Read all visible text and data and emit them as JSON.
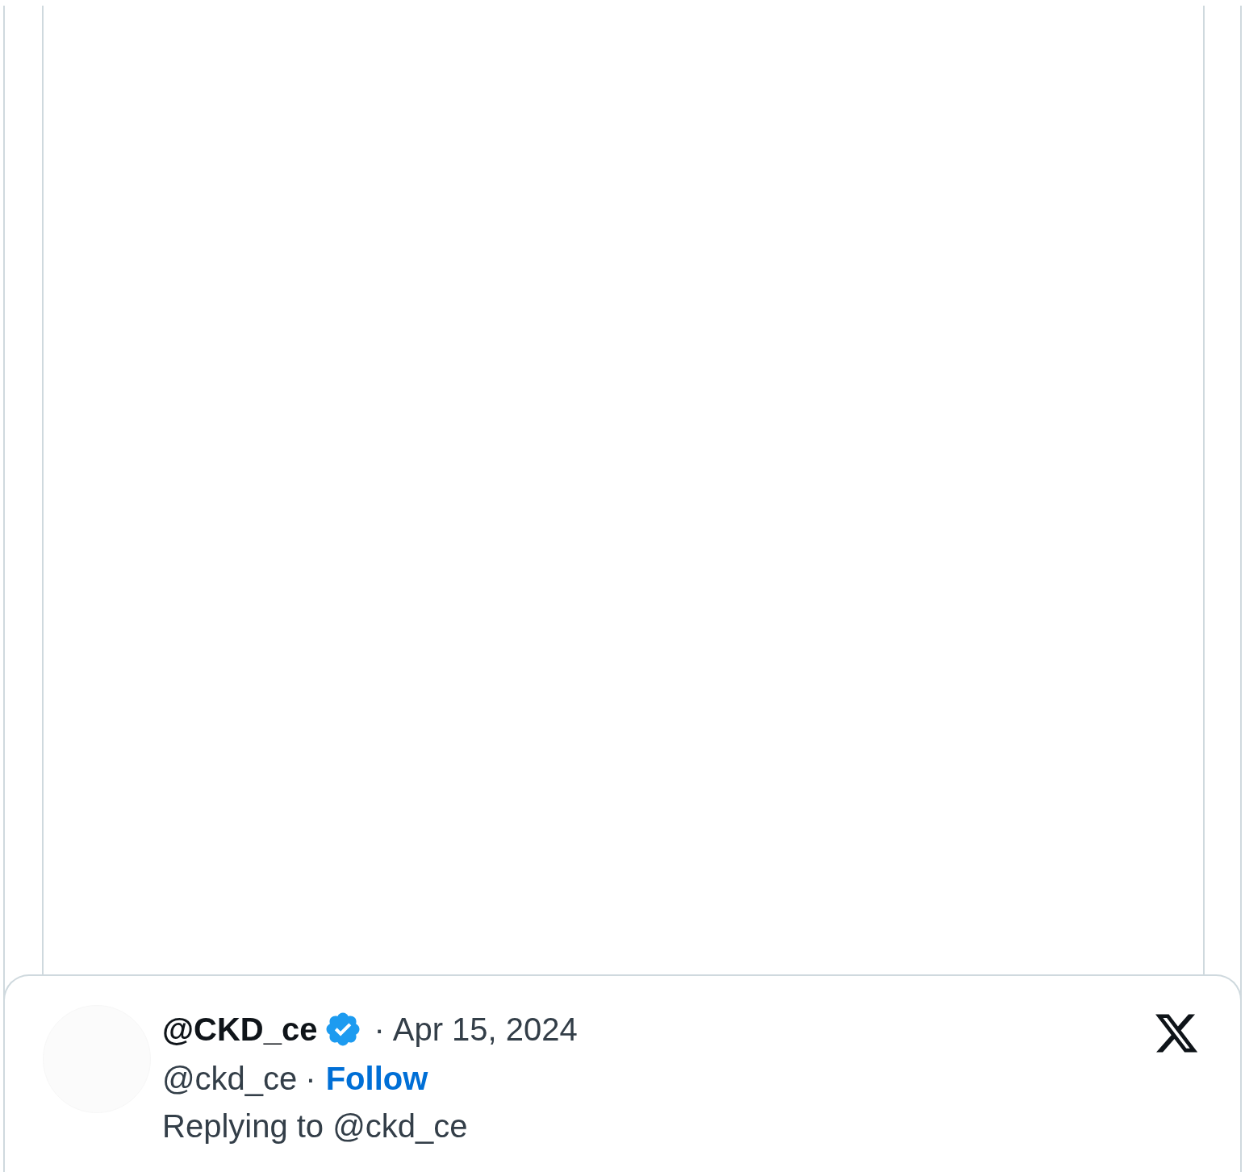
{
  "tweet": {
    "display_name": "@CKD_ce",
    "verified": true,
    "date_separator": "·",
    "date": "Apr 15, 2024",
    "handle": "@ckd_ce",
    "handle_separator": "·",
    "follow": "Follow",
    "replying_to": "Replying to @ckd_ce"
  }
}
